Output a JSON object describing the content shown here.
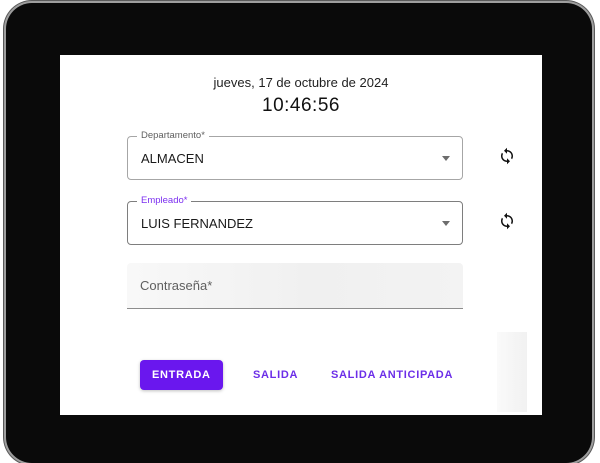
{
  "header": {
    "date": "jueves, 17 de octubre de 2024",
    "time": "10:46:56"
  },
  "form": {
    "departamento": {
      "label": "Departamento*",
      "value": "ALMACEN",
      "refresh_icon": "sync-icon"
    },
    "empleado": {
      "label": "Empleado*",
      "value": "LUIS FERNANDEZ",
      "refresh_icon": "sync-icon"
    },
    "password": {
      "placeholder": "Contraseña*",
      "value": ""
    }
  },
  "actions": {
    "entrada": "ENTRADA",
    "salida": "SALIDA",
    "salida_anticipada": "SALIDA ANTICIPADA"
  },
  "colors": {
    "primary": "#6a17ee",
    "accent_label": "#7c2ff0",
    "frame": "#0a0a0a"
  }
}
